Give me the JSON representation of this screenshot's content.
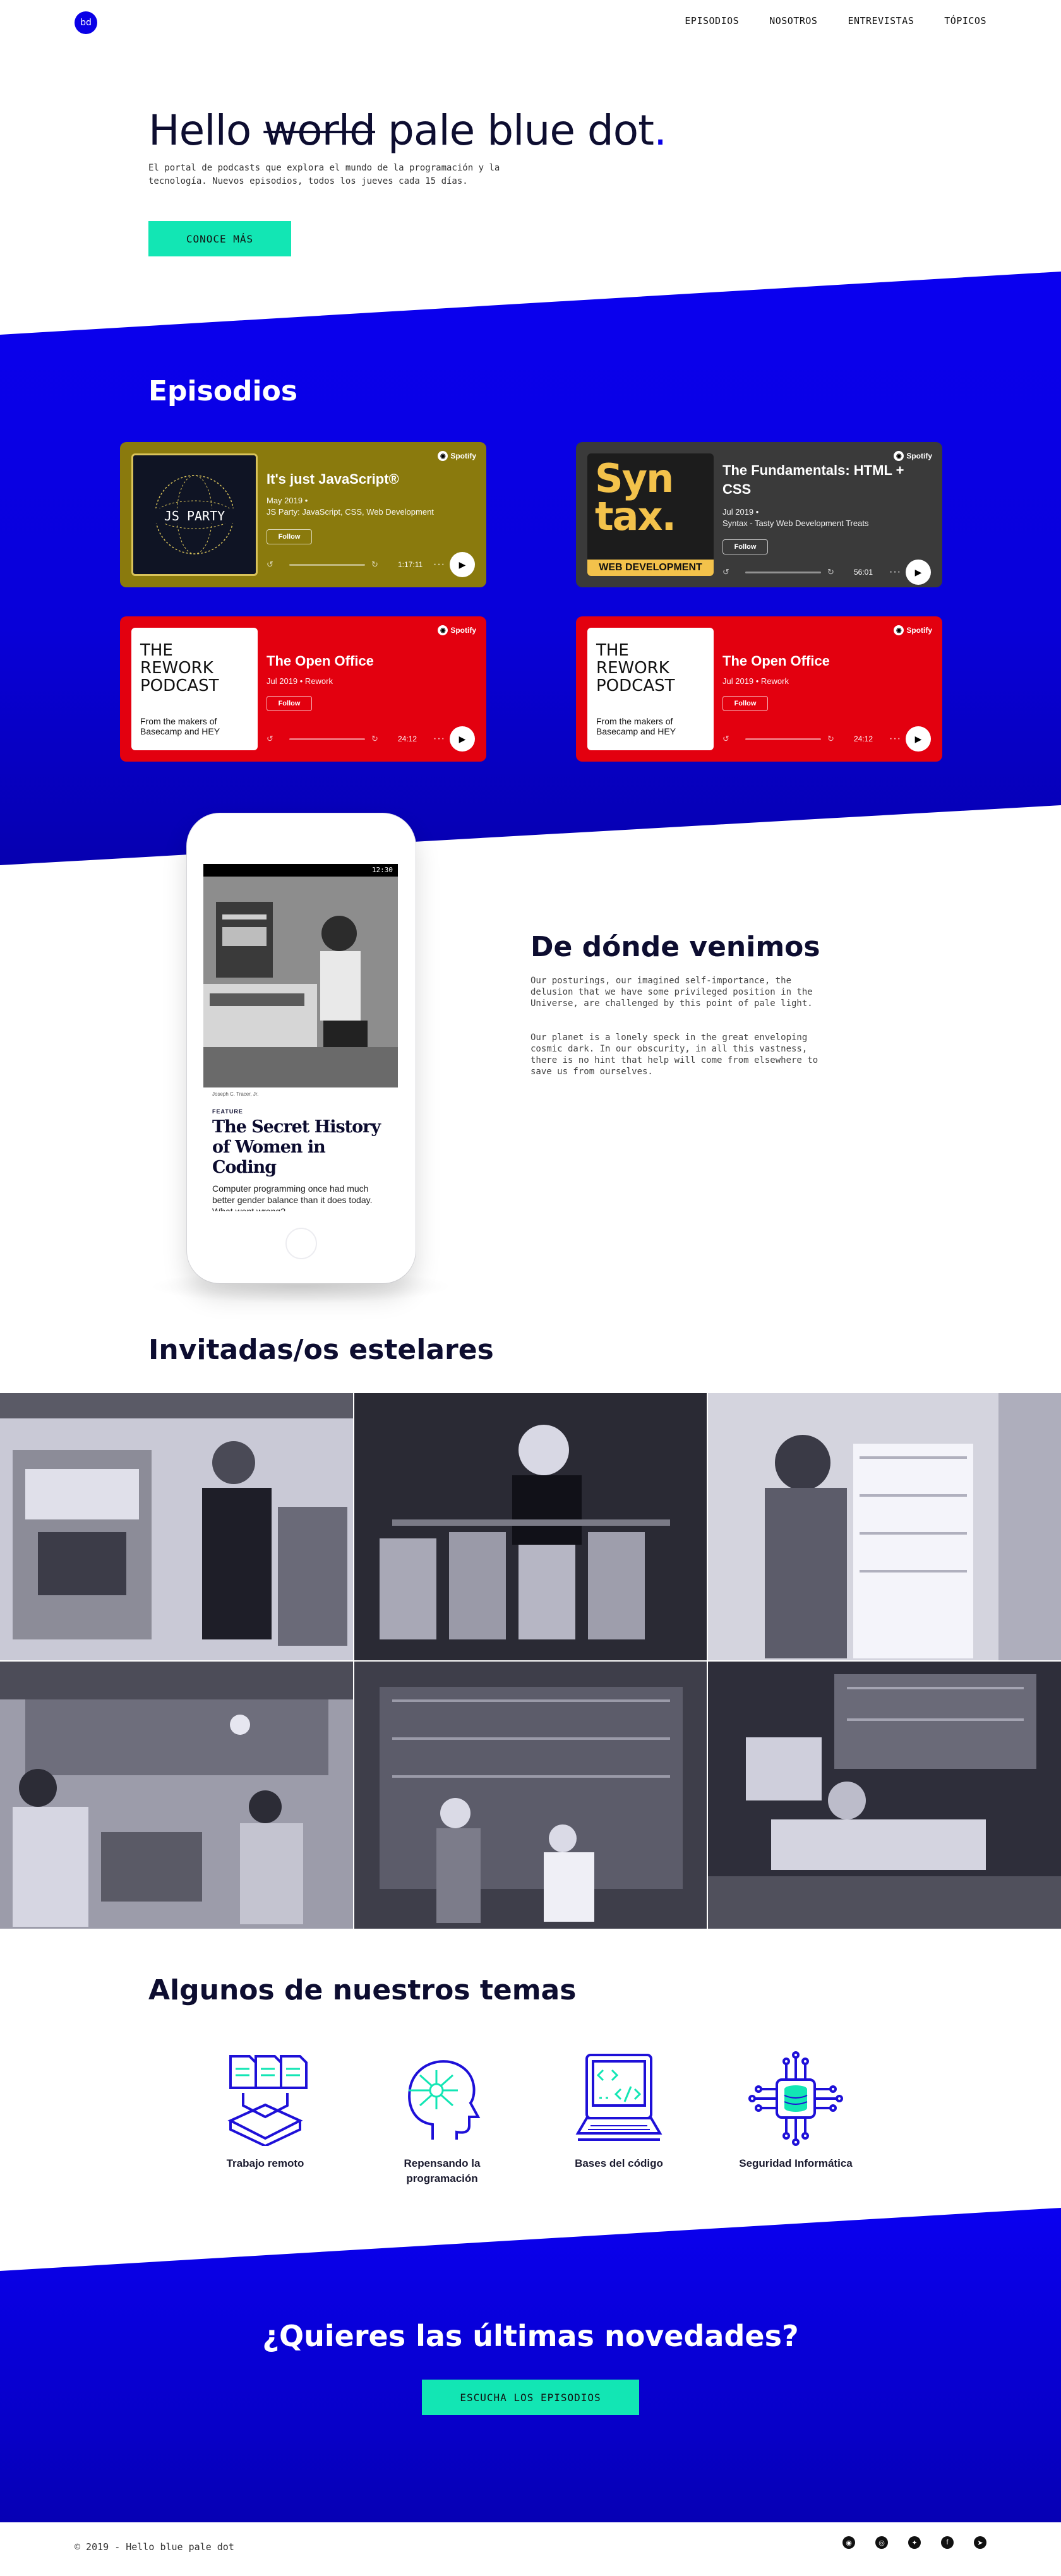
{
  "header": {
    "logo": "bd",
    "nav": [
      "EPISODIOS",
      "NOSOTROS",
      "ENTREVISTAS",
      "TÓPICOS"
    ]
  },
  "hero": {
    "title_prefix": "Hello",
    "title_strike": "world",
    "title_suffix": "pale blue dot",
    "title_dot": ".",
    "subtitle": "El portal de podcasts que explora el mundo de la programación y la tecnología. Nuevos episodios, todos los jueves cada 15 días.",
    "cta": "CONOCE MÁS"
  },
  "episodes": {
    "title": "Episodios",
    "cards": [
      {
        "art_text": "JS PARTY",
        "title": "It's just JavaScript®",
        "date": "May 2019  •",
        "show": "JS Party: JavaScript, CSS, Web Development",
        "follow": "Follow",
        "duration": "1:17:11",
        "spotify": "Spotify",
        "color": "#8a7a0d"
      },
      {
        "art_text": "Syn tax.",
        "art_sub": "WEB DEVELOPMENT",
        "title": "The Fundamentals: HTML + CSS",
        "date": "Jul 2019  •",
        "show": "Syntax - Tasty Web Development Treats",
        "follow": "Follow",
        "duration": "56:01",
        "spotify": "Spotify",
        "color": "#3a3a3a"
      },
      {
        "art_text": "THE REWORK PODCAST",
        "art_sub": "From the makers of Basecamp and HEY",
        "title": "The Open Office",
        "date": "Jul 2019  •  Rework",
        "show": "",
        "follow": "Follow",
        "duration": "24:12",
        "spotify": "Spotify",
        "color": "#e3000f"
      },
      {
        "art_text": "THE REWORK PODCAST",
        "art_sub": "From the makers of Basecamp and HEY",
        "title": "The Open Office",
        "date": "Jul 2019  •  Rework",
        "show": "",
        "follow": "Follow",
        "duration": "24:12",
        "spotify": "Spotify",
        "color": "#e3000f"
      }
    ]
  },
  "phone": {
    "status": "12:30",
    "caption": "Joseph C. Tracer, Jr.",
    "feature": "FEATURE",
    "story_title": "The Secret History of Women in Coding",
    "story_dek": "Computer programming once had much better gender balance than it does today. What went wrong?"
  },
  "about": {
    "title": "De dónde venimos",
    "p1": "Our posturings, our imagined self-importance, the delusion that we have some privileged position in the Universe, are challenged by this point of pale light.",
    "p2": "Our planet is a lonely speck in the great enveloping cosmic dark. In our obscurity, in all this vastness, there is no hint that help will come from elsewhere to save us from ourselves."
  },
  "guests": {
    "title": "Invitadas/os estelares"
  },
  "topics": {
    "title": "Algunos de nuestros temas",
    "items": [
      {
        "label": "Trabajo remoto",
        "icon": "documents-icon"
      },
      {
        "label": "Repensando la programación",
        "icon": "brain-head-icon"
      },
      {
        "label": "Bases del código",
        "icon": "laptop-code-icon"
      },
      {
        "label": "Seguridad Informática",
        "icon": "circuit-database-icon"
      }
    ]
  },
  "cta": {
    "title": "¿Quieres las últimas novedades?",
    "button": "ESCUCHA LOS EPISODIOS"
  },
  "footer": {
    "copy": "© 2019 - Hello blue pale dot"
  },
  "colors": {
    "brand_blue": "#0a00e6",
    "accent_teal": "#12e6b4"
  }
}
